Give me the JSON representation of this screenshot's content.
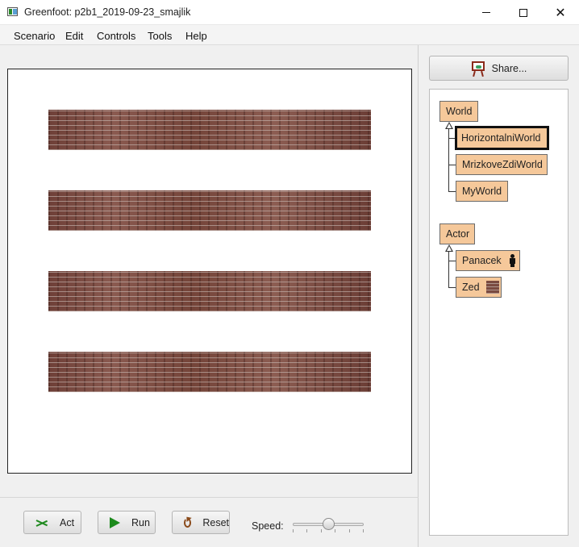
{
  "window": {
    "title": "Greenfoot: p2b1_2019-09-23_smajlik"
  },
  "menubar": {
    "items": [
      "Scenario",
      "Edit",
      "Controls",
      "Tools",
      "Help"
    ]
  },
  "controls": {
    "act_label": "Act",
    "run_label": "Run",
    "reset_label": "Reset",
    "speed_label": "Speed:",
    "speed_value": 0.5
  },
  "sidebar": {
    "share_label": "Share...",
    "world_classes": {
      "root": "World",
      "children": [
        "HorizontalniWorld",
        "MrizkoveZdiWorld",
        "MyWorld"
      ],
      "selected": "HorizontalniWorld"
    },
    "actor_classes": {
      "root": "Actor",
      "children": [
        "Panacek",
        "Zed"
      ]
    }
  },
  "icons": {
    "app": "greenfoot-app-icon",
    "share": "easel-icon",
    "act": "act-icon",
    "run": "play-icon",
    "reset": "reset-icon",
    "panacek": "person-icon",
    "zed": "brick-wall-icon"
  },
  "colors": {
    "class_box": "#f5c89a",
    "brick": "#7a4a40",
    "play_green": "#1c8a1c"
  }
}
